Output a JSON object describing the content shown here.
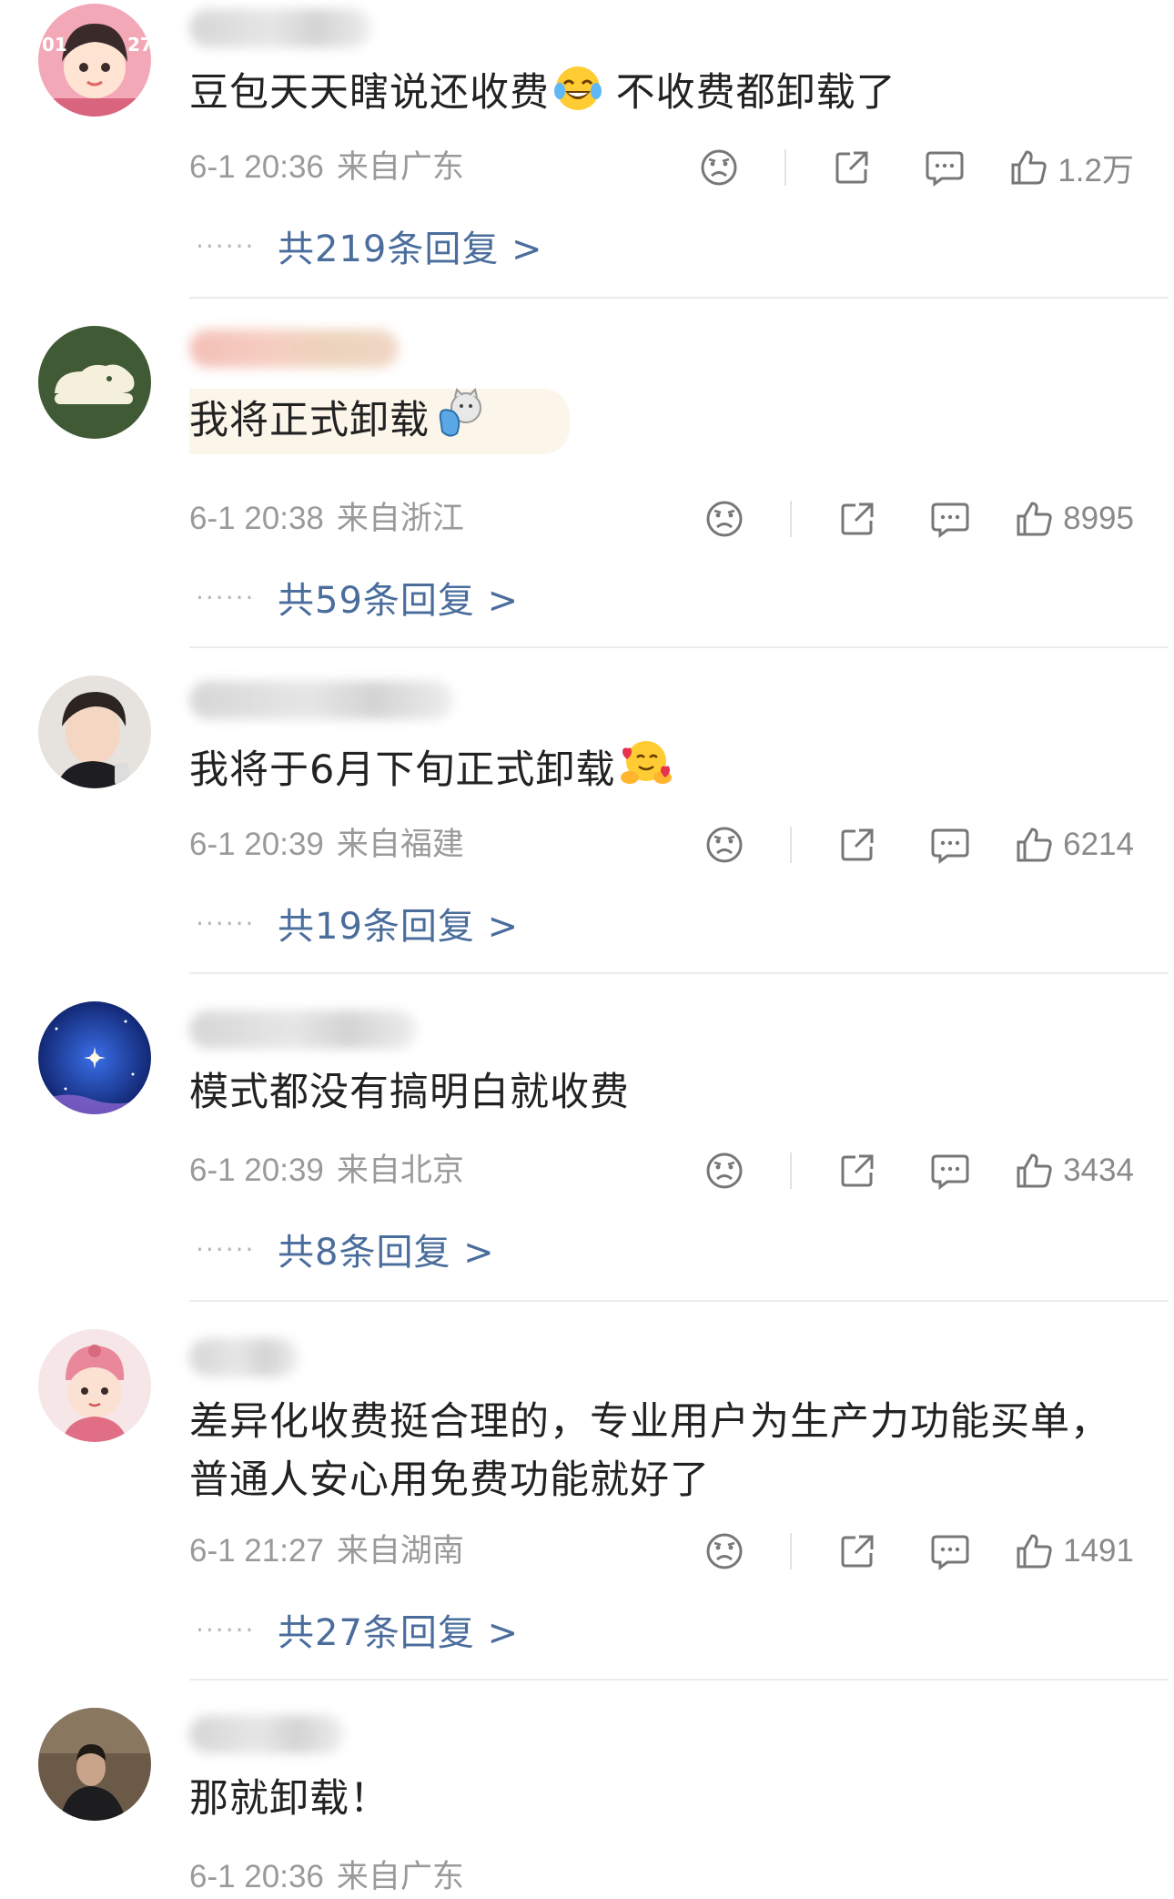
{
  "comments": [
    {
      "text": "豆包天天瞎说还收费",
      "text_after": " 不收费都卸载了",
      "emoji": "tears-of-joy-emoji",
      "date": "6-1 20:36",
      "location": "来自广东",
      "likes": "1.2万",
      "replies_label": "共219条回复 >"
    },
    {
      "text": "我将正式卸载",
      "emoji": "cat-sticker-emoji",
      "date": "6-1 20:38",
      "location": "来自浙江",
      "likes": "8995",
      "replies_label": "共59条回复 >"
    },
    {
      "text": "我将于6月下旬正式卸载",
      "emoji": "hugging-face-emoji",
      "date": "6-1 20:39",
      "location": "来自福建",
      "likes": "6214",
      "replies_label": "共19条回复 >"
    },
    {
      "text": "模式都没有搞明白就收费",
      "date": "6-1 20:39",
      "location": "来自北京",
      "likes": "3434",
      "replies_label": "共8条回复 >"
    },
    {
      "text": "差异化收费挺合理的，专业用户为生产力功能买单，",
      "text_line2": "普通人安心用免费功能就好了",
      "date": "6-1 21:27",
      "location": "来自湖南",
      "likes": "1491",
      "replies_label": "共27条回复 >"
    },
    {
      "text": "那就卸载！",
      "date": "6-1 20:36",
      "location": "来自广东"
    }
  ],
  "colors": {
    "link": "#4a6d9c",
    "meta": "#9a9a9a",
    "text": "#222222",
    "divider": "#ececec"
  }
}
